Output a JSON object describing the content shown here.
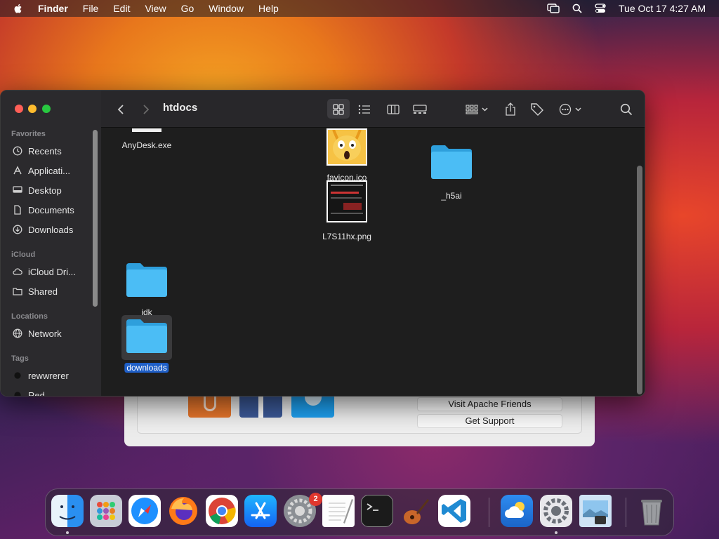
{
  "menubar": {
    "app_name": "Finder",
    "menus": [
      "File",
      "Edit",
      "View",
      "Go",
      "Window",
      "Help"
    ],
    "clock": "Tue Oct 17  4:27 AM"
  },
  "background_window": {
    "buttons": [
      "Visit Apache Friends",
      "Get Support"
    ]
  },
  "finder": {
    "title": "htdocs",
    "sidebar": {
      "favorites_header": "Favorites",
      "favorites": [
        "Recents",
        "Applicati...",
        "Desktop",
        "Documents",
        "Downloads"
      ],
      "icloud_header": "iCloud",
      "icloud": [
        "iCloud Dri...",
        "Shared"
      ],
      "locations_header": "Locations",
      "locations": [
        "Network"
      ],
      "tags_header": "Tags",
      "tags": [
        "rewwrerer",
        "Red"
      ]
    },
    "files": [
      {
        "name": "AnyDesk.exe",
        "kind": "exe"
      },
      {
        "name": "favicon.ico",
        "kind": "image"
      },
      {
        "name": "_h5ai",
        "kind": "folder"
      },
      {
        "name": "L7S11hx.png",
        "kind": "image"
      },
      {
        "name": "idk",
        "kind": "folder"
      },
      {
        "name": "downloads",
        "kind": "folder",
        "selected": true
      }
    ]
  },
  "dock": {
    "apps": [
      "Finder",
      "Launchpad",
      "Safari",
      "Firefox",
      "Chrome",
      "App Store",
      "System Preferences",
      "TextEdit",
      "Terminal",
      "GarageBand",
      "Visual Studio Code",
      "Weather",
      "System Settings",
      "Preview",
      "Trash"
    ],
    "system_preferences_badge": "2"
  },
  "colors": {
    "selection": "#1f5fc7",
    "folder": "#3ab4f2",
    "close": "#ff5f57",
    "minimize": "#febc2e",
    "zoom": "#28c840"
  }
}
